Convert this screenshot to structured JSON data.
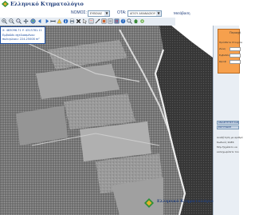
{
  "header": {
    "logo_text": "Ελληνικό Κτηματολόγιο"
  },
  "filters": {
    "nomos_label": "ΝΟΜΟΣ:",
    "nomos_value": "ΕΥΒΟΙΑΣ",
    "ota_label": "ΟΤΑ:",
    "ota_value": "ΑΓΙΟΥ ΑΘΑΝΑΣΙΟΥ",
    "go_label": "Μετάβαση"
  },
  "toolbar": {
    "icons": [
      "zoom-in-icon",
      "zoom-out-icon",
      "zoom-extent-icon",
      "pan-icon",
      "full-extent-icon",
      "prev-view-icon",
      "next-view-icon",
      "measure-icon",
      "identify-icon",
      "info-icon",
      "print-icon",
      "clear-icon",
      "select-icon",
      "query-icon",
      "locate-icon",
      "layers-icon",
      "legend-icon",
      "overview-icon",
      "help-icon",
      "search-icon",
      "home-icon",
      "settings-icon"
    ]
  },
  "coords": {
    "line1": "X: 483096.71   Y: 4313781.11",
    "line2": "Εμβαδόν σχεδιασμένου πολυγώνου: 224.25008 m²"
  },
  "panel": {
    "title": "Περιοχή",
    "row1_label": "Πρόσθετα Στοιχεία",
    "row2_label": "Ζώνη",
    "row3_label": "Εμβαδόν γεω...",
    "row4_label": "Ωρ/εβ",
    "btn1_label": "ΑΝΑΖΗΤΗΣΗ ΚΑΕΚ",
    "btn2_label": "ΕΚΤΥΠΩΣΗ",
    "note1": "Αναζήτηση με αριθμό",
    "note2": "Κωδικός ΚΑΕΚ",
    "note3": "Μην ξεχάσετε να",
    "note4": "καταχωρίσετε τον"
  },
  "footer": {
    "logo_text": "Ελληνικό Κτηματολόγιο"
  }
}
